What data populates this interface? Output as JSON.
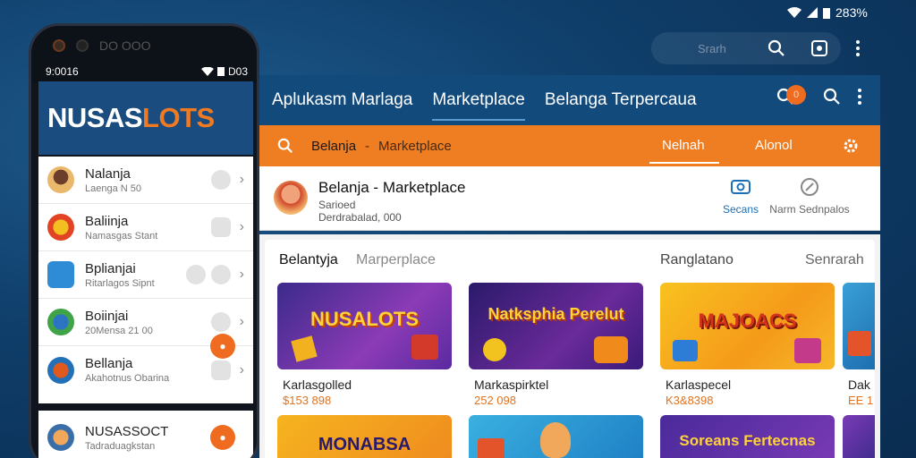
{
  "top_status": {
    "battery_text": "283%"
  },
  "bg_search": {
    "placeholder": "Srarh"
  },
  "phone": {
    "top_label": "DO OOO",
    "time": "9:0016",
    "status_right": "D03",
    "logo_part1": "NUSAS",
    "logo_part2": "LOTS",
    "items": [
      {
        "name": "Nalanja",
        "sub": "Laenga N 50"
      },
      {
        "name": "Baliinja",
        "sub": "Namasgas Stant"
      },
      {
        "name": "Bplianjai",
        "sub": "Ritarlagos Sipnt"
      },
      {
        "name": "Boiinjai",
        "sub": "20Mensa 21 00"
      },
      {
        "name": "Bellanja",
        "sub": "Akahotnus Obarina"
      }
    ],
    "card": {
      "name": "NUSASSOCT",
      "sub": "Tadraduagkstan"
    }
  },
  "app": {
    "tabs": [
      "Aplukasm Marlaga",
      "Marketplace",
      "Belanga Terpercaua"
    ],
    "notif_count": "0",
    "search_label": "Belanja",
    "search_sep": "-",
    "search_sub": "Marketplace",
    "tab_right1": "Nelnah",
    "tab_right2": "Alonol",
    "seller": {
      "title": "Belanja - Marketplace",
      "sub1": "Sarioed",
      "sub2": "Derdrabalad, 000",
      "action1": "Secans",
      "action2": "Narm Sednpalos"
    },
    "content_tabs": [
      "Belantyja",
      "Marperplace",
      "Ranglatano",
      "Senrarah"
    ],
    "tiles": [
      {
        "name": "Karlasgolled",
        "price": "$153 898",
        "art": "NUSALOTS"
      },
      {
        "name": "Markaspirktel",
        "price": "252 098",
        "art": "Natksphia Perelut"
      },
      {
        "name": "Karlaspecel",
        "price": "K3&8398",
        "art": "MAJOACS"
      },
      {
        "name": "Dak",
        "price": "EE 1",
        "art": ""
      }
    ],
    "row2_art": [
      "MONABSA",
      "",
      "Soreans Fertecnas",
      ""
    ]
  },
  "colors": {
    "brand_blue": "#124a7c",
    "accent_orange": "#ef7d22"
  }
}
